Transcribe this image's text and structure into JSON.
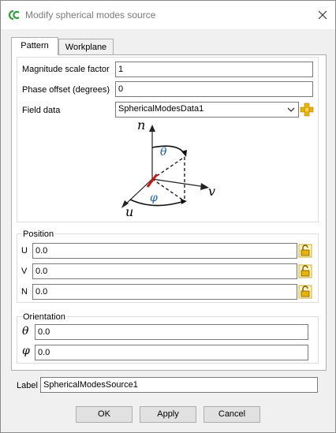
{
  "window": {
    "title": "Modify spherical modes source"
  },
  "tabs": [
    {
      "label": "Pattern"
    },
    {
      "label": "Workplane"
    }
  ],
  "pattern": {
    "magnitude_label": "Magnitude scale factor",
    "magnitude_value": "1",
    "phase_label": "Phase offset (degrees)",
    "phase_value": "0",
    "field_data_label": "Field data",
    "field_data_value": "SphericalModesData1"
  },
  "diagram": {
    "n": "n",
    "v": "v",
    "u": "u",
    "theta": "θ",
    "phi": "φ"
  },
  "position": {
    "legend": "Position",
    "u_label": "U",
    "u_value": "0.0",
    "v_label": "V",
    "v_value": "0.0",
    "n_label": "N",
    "n_value": "0.0"
  },
  "orientation": {
    "legend": "Orientation",
    "theta_label": "θ",
    "theta_value": "0.0",
    "phi_label": "φ",
    "phi_value": "0.0"
  },
  "label_field": {
    "label": "Label",
    "value": "SphericalModesSource1"
  },
  "buttons": {
    "ok": "OK",
    "apply": "Apply",
    "cancel": "Cancel"
  },
  "colors": {
    "accent_green": "#2e9e3e",
    "lock_yellow": "#e8b400",
    "dipole_red": "#d01010",
    "theta_blue": "#1a5fa8"
  }
}
